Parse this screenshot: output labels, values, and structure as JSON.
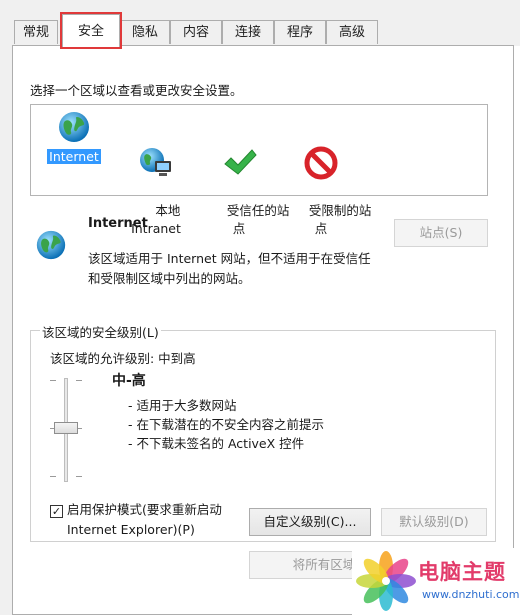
{
  "tabs": [
    {
      "label": "常规",
      "active": false
    },
    {
      "label": "安全",
      "active": true
    },
    {
      "label": "隐私",
      "active": false
    },
    {
      "label": "内容",
      "active": false
    },
    {
      "label": "连接",
      "active": false
    },
    {
      "label": "程序",
      "active": false
    },
    {
      "label": "高级",
      "active": false
    }
  ],
  "zone_prompt": "选择一个区域以查看或更改安全设置。",
  "zones": [
    {
      "label": "Internet",
      "icon": "globe-icon",
      "selected": true
    },
    {
      "label": "本地\nIntranet",
      "icon": "local-intranet-icon",
      "selected": false
    },
    {
      "label": "受信任的站\n点",
      "icon": "checkmark-icon",
      "selected": false
    },
    {
      "label": "受限制的站\n点",
      "icon": "no-entry-icon",
      "selected": false
    }
  ],
  "info": {
    "title": "Internet",
    "description_line1": "该区域适用于 Internet 网站，但不适用于在受信任",
    "description_line2": "和受限制区域中列出的网站。",
    "sites_button": "站点(S)"
  },
  "security_level": {
    "group_title": "该区域的安全级别(L)",
    "allowed": "该区域的允许级别: 中到高",
    "level_name": "中-高",
    "bullets": [
      "- 适用于大多数网站",
      "- 在下载潜在的不安全内容之前提示",
      "- 不下载未签名的 ActiveX 控件"
    ],
    "protected_mode_line1": "启用保护模式(要求重新启动",
    "protected_mode_line2": "Internet Explorer)(P)",
    "protected_mode_checked": true,
    "custom_level_button": "自定义级别(C)...",
    "default_level_button": "默认级别(D)",
    "reset_all_button": "将所有区域"
  },
  "watermark": {
    "text": "电脑主题",
    "url": "www.dnzhuti.com"
  },
  "colors": {
    "selection": "#3399ff",
    "highlight_border": "#e0393a",
    "watermark_text": "#e23b6a"
  }
}
